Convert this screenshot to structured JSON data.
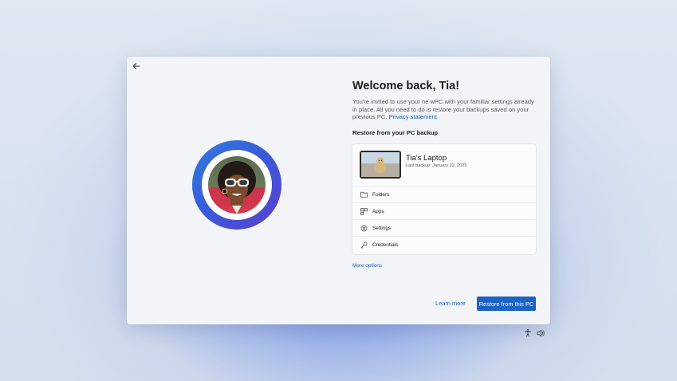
{
  "dialog": {
    "title": "Welcome back, Tia!",
    "description": "You're invited to use your ne wPC with your familiar settings already in place. All you need to do is restore your backups saved on your previous PC.",
    "privacy_link": "Privacy statement",
    "section_heading": "Restore from your PC backup",
    "device": {
      "name": "Tia's Laptop",
      "last_backup": "Last backup: January 22, 2025"
    },
    "items": [
      {
        "label": "Folders",
        "icon": "folder-icon"
      },
      {
        "label": "Apps",
        "icon": "apps-icon"
      },
      {
        "label": "Settings",
        "icon": "gear-icon"
      },
      {
        "label": "Credentials",
        "icon": "key-icon"
      }
    ],
    "more_options": "More options",
    "learn_more": "Learn more",
    "restore_button": "Restore from this PC"
  },
  "icons": {
    "back": "back-arrow-icon",
    "accessibility": "accessibility-icon",
    "volume": "volume-icon"
  },
  "colors": {
    "accent": "#1b63c4",
    "link": "#1561b8",
    "avatar_ring_start": "#2f7be0",
    "avatar_ring_end": "#5b3fce"
  }
}
